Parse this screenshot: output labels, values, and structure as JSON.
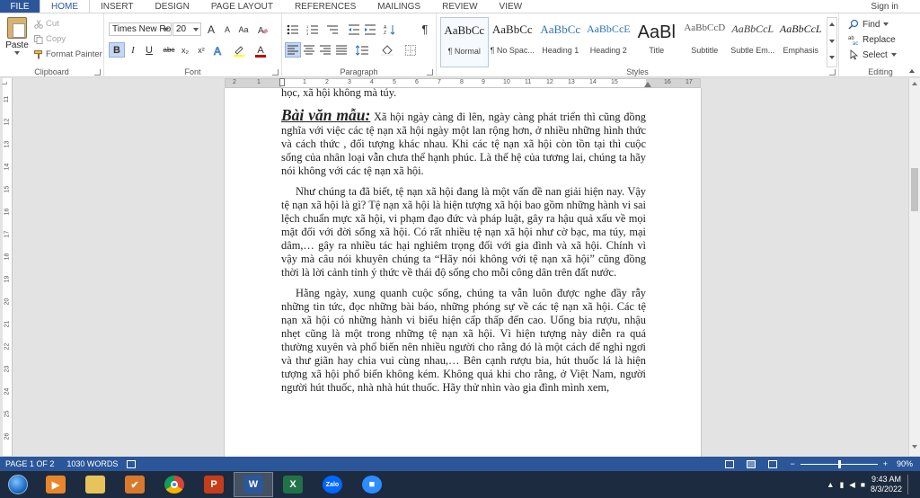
{
  "ribbon_tabs": {
    "file": "FILE",
    "home": "HOME",
    "insert": "INSERT",
    "design": "DESIGN",
    "page_layout": "PAGE LAYOUT",
    "references": "REFERENCES",
    "mailings": "MAILINGS",
    "review": "REVIEW",
    "view": "VIEW",
    "sign_in": "Sign in"
  },
  "clipboard": {
    "paste": "Paste",
    "cut": "Cut",
    "copy": "Copy",
    "format_painter": "Format Painter",
    "label": "Clipboard"
  },
  "font": {
    "name": "Times New Ro",
    "size": "20",
    "label": "Font",
    "bold": "B",
    "italic": "I",
    "underline": "U",
    "strike": "abc",
    "subscript": "x₂",
    "superscript": "x²",
    "grow": "A",
    "shrink": "A",
    "case": "Aa",
    "font_color": "A"
  },
  "paragraph": {
    "label": "Paragraph",
    "pilcrow": "¶"
  },
  "styles": {
    "label": "Styles",
    "items": [
      {
        "sample": "AaBbCc",
        "name": "¶ Normal"
      },
      {
        "sample": "AaBbCc",
        "name": "¶ No Spac..."
      },
      {
        "sample": "AaBbCc",
        "name": "Heading 1"
      },
      {
        "sample": "AaBbCcE",
        "name": "Heading 2"
      },
      {
        "sample": "AaBl",
        "name": "Title"
      },
      {
        "sample": "AaBbCcD",
        "name": "Subtitle"
      },
      {
        "sample": "AaBbCcL",
        "name": "Subtle Em..."
      },
      {
        "sample": "AaBbCcL",
        "name": "Emphasis"
      }
    ]
  },
  "editing": {
    "find": "Find",
    "replace": "Replace",
    "select": "Select",
    "label": "Editing"
  },
  "ruler": {
    "h_numbers": [
      "2",
      "1",
      "1",
      "2",
      "3",
      "4",
      "5",
      "6",
      "7",
      "8",
      "9",
      "10",
      "11",
      "12",
      "13",
      "14",
      "15",
      "16",
      "17",
      "18"
    ],
    "v_numbers": [
      "11",
      "12",
      "13",
      "14",
      "15",
      "16",
      "17",
      "18",
      "19",
      "20",
      "21",
      "22",
      "23",
      "24",
      "25",
      "26"
    ],
    "v_top": "L"
  },
  "document": {
    "line_top": "học, xã hội không mà túy.",
    "heading": "Bài văn mẫu:",
    "p1_rest": " Xã hội ngày càng đi lên, ngày càng phát triển thì cũng đồng nghĩa với việc các tệ nạn xã hội ngày một lan rộng hơn, ở nhiều những hình thức và cách thức , đối tượng khác nhau. Khi các tệ nạn xã hội còn tồn tại thì cuộc sống của nhân loại vẫn chưa thể hạnh phúc. Là thế hệ của tương lai, chúng ta hãy nói không với các tệ nạn xã hội.",
    "p2": "Như chúng ta đã biết, tệ nạn xã hội đang là một vấn đề nan giải hiện nay. Vậy tệ nạn xã hội là gì? Tệ nạn xã hội là hiện tượng xã hội bao gồm những hành vi sai lệch chuẩn mực xã hội, vi phạm đạo đức và pháp luật, gây ra hậu quả xấu về mọi mặt đối với đời sống xã hội. Có rất nhiều tệ nạn xã hội như cờ bạc, ma túy, mại dâm,… gây ra nhiều tác hại nghiêm trọng đối với gia đình và xã hội. Chính vì vậy mà câu nói khuyên chúng ta “Hãy nói không với tệ nạn xã hội” cũng đồng thời là lời cảnh tỉnh ý thức về thái độ sống cho mỗi công dân trên đất nước.",
    "p3": "Hằng ngày, xung quanh cuộc sống, chúng ta vẫn luôn được nghe đầy rẫy những tin tức, đọc những bài báo, những phóng sự về các tệ nạn xã hội. Các tệ nạn xã hội có những hành vi biểu hiện cấp thấp đến cao. Uống bia rượu, nhậu nhẹt cũng là một trong những tệ nạn xã hội. Vì hiện tượng này diễn ra quá thường xuyên và phổ biến nên nhiều người cho rằng đó là một cách để nghỉ ngơi và thư giãn hay chia vui cùng nhau,… Bên cạnh rượu bia, hút thuốc lá là hiện tượng xã hội phổ biến không kém. Không quá khi cho rằng, ở Việt Nam, người người hút thuốc, nhà nhà hút thuốc. Hãy thử nhìn vào gia đình mình xem,"
  },
  "status": {
    "page": "PAGE 1 OF 2",
    "words": "1030 WORDS",
    "zoom": "90%",
    "zoom_level": 0.9
  },
  "taskbar": {
    "time": "9:43 AM",
    "date": "8/3/2022",
    "apps": [
      "Windows Media Player",
      "File Explorer",
      "Store",
      "Chrome",
      "PowerPoint",
      "Word",
      "Excel",
      "Zalo",
      "Zoom"
    ]
  },
  "colors": {
    "accent": "#2b579a",
    "taskbar": "#1c2b3f"
  }
}
